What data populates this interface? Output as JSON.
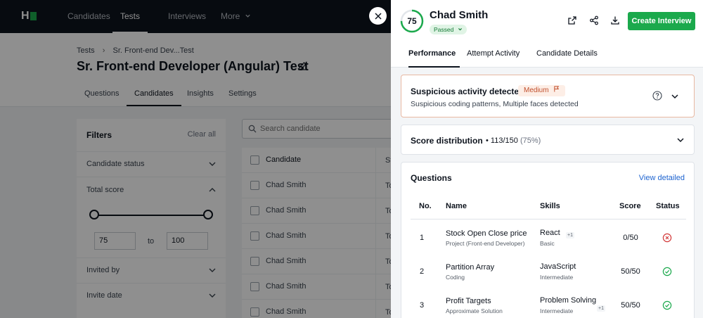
{
  "topnav": {
    "logo_letter": "H",
    "items": [
      "Candidates",
      "Tests",
      "Interviews",
      "More"
    ]
  },
  "breadcrumb": {
    "root": "Tests",
    "current": "Sr. Front-end Dev...Test"
  },
  "page_title": "Sr. Front-end Developer (Angular) Test",
  "subtabs": [
    "Questions",
    "Candidates",
    "Insights",
    "Settings"
  ],
  "filters": {
    "title": "Filters",
    "clear": "Clear all",
    "candidate_status": "Candidate status",
    "total_score": "Total score",
    "range_min": "75",
    "range_to": "to",
    "range_max": "100",
    "invited_by": "Invited by",
    "invite_date": "Invite date"
  },
  "search": {
    "placeholder": "Search candidate"
  },
  "table": {
    "header": "Candidate",
    "header2": "St",
    "rows": [
      "Chad Smith",
      "Chad Smith",
      "Chad Smith",
      "Chad Smith",
      "Chad Smith",
      "Chad Smith"
    ],
    "col2": "To"
  },
  "panel": {
    "score": "75",
    "score_fraction": 0.75,
    "candidate_name": "Chad Smith",
    "status": "Passed",
    "create_button": "Create Interview",
    "tabs": [
      "Performance",
      "Attempt Activity",
      "Candidate Details"
    ],
    "suspicious": {
      "title": "Suspicious activity detected",
      "level": "Medium",
      "detail": "Suspicious coding patterns, Multiple faces detected"
    },
    "distribution": {
      "title": "Score distribution",
      "score": "113/150",
      "percent": "(75%)"
    },
    "questions": {
      "title": "Questions",
      "view_link": "View detailed",
      "headers": {
        "no": "No.",
        "name": "Name",
        "skills": "Skills",
        "score": "Score",
        "status": "Status"
      },
      "rows": [
        {
          "no": "1",
          "name": "Stock Open Close price",
          "type": "Project (Front-end Developer)",
          "skill": "React",
          "extra": "+1",
          "level": "Basic",
          "score": "0/50",
          "status": "failed"
        },
        {
          "no": "2",
          "name": "Partition Array",
          "type": "Coding",
          "skill": "JavaScript",
          "extra": "",
          "level": "Intermediate",
          "score": "50/50",
          "status": "passed"
        },
        {
          "no": "3",
          "name": "Profit Targets",
          "type": "Approximate Solution",
          "skill": "Problem Solving",
          "extra": "+1",
          "level": "Intermediate",
          "score": "50/50",
          "status": "passed"
        }
      ]
    }
  },
  "colors": {
    "brand_green": "#1ba94c",
    "fail_red": "#d33a3a",
    "warn_orange": "#c1502e",
    "link_blue": "#1e64d0"
  }
}
